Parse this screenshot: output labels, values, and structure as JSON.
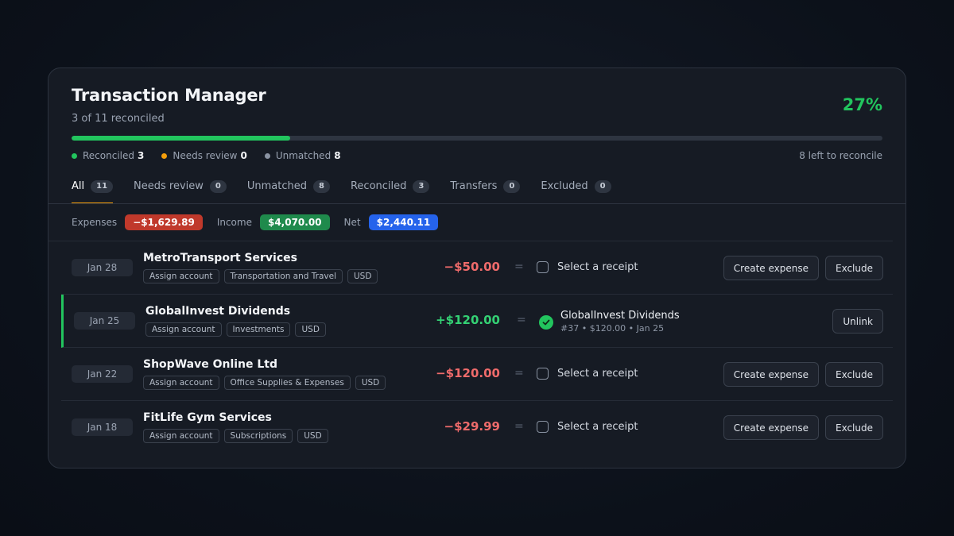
{
  "header": {
    "title": "Transaction Manager",
    "subtitle": "3 of 11 reconciled",
    "percent": "27%",
    "progress_fraction": 0.27,
    "left_to_reconcile": "8 left to reconcile",
    "accent_color": "#22c55e"
  },
  "legend": [
    {
      "label": "Reconciled",
      "count": "3",
      "color": "#22c55e"
    },
    {
      "label": "Needs review",
      "count": "0",
      "color": "#f59e0b"
    },
    {
      "label": "Unmatched",
      "count": "8",
      "color": "#8a93a2"
    }
  ],
  "tabs": [
    {
      "label": "All",
      "count": "11",
      "active": true
    },
    {
      "label": "Needs review",
      "count": "0"
    },
    {
      "label": "Unmatched",
      "count": "8"
    },
    {
      "label": "Reconciled",
      "count": "3"
    },
    {
      "label": "Transfers",
      "count": "0"
    },
    {
      "label": "Excluded",
      "count": "0"
    }
  ],
  "summary": {
    "expenses_label": "Expenses",
    "expenses_value": "−$1,629.89",
    "income_label": "Income",
    "income_value": "$4,070.00",
    "net_label": "Net",
    "net_value": "$2,440.11"
  },
  "transactions": [
    {
      "date": "Jan 28",
      "merchant": "MetroTransport Services",
      "tags": [
        "Assign account",
        "Transportation and Travel",
        "USD"
      ],
      "amount": "−$50.00",
      "sign": "neg",
      "eq": "=",
      "receipt_label": "Select a receipt",
      "actions": [
        "Create expense",
        "Exclude"
      ]
    },
    {
      "date": "Jan 25",
      "merchant": "GlobalInvest Dividends",
      "tags": [
        "Assign account",
        "Investments",
        "USD"
      ],
      "amount": "+$120.00",
      "sign": "pos",
      "eq": "=",
      "matched": {
        "title": "GlobalInvest Dividends",
        "sub": "#37 • $120.00 • Jan 25"
      },
      "actions": [
        "Unlink"
      ]
    },
    {
      "date": "Jan 22",
      "merchant": "ShopWave Online Ltd",
      "tags": [
        "Assign account",
        "Office Supplies & Expenses",
        "USD"
      ],
      "amount": "−$120.00",
      "sign": "neg",
      "eq": "=",
      "receipt_label": "Select a receipt",
      "actions": [
        "Create expense",
        "Exclude"
      ]
    },
    {
      "date": "Jan 18",
      "merchant": "FitLife Gym Services",
      "tags": [
        "Assign account",
        "Subscriptions",
        "USD"
      ],
      "amount": "−$29.99",
      "sign": "neg",
      "eq": "=",
      "receipt_label": "Select a receipt",
      "actions": [
        "Create expense",
        "Exclude"
      ]
    }
  ]
}
